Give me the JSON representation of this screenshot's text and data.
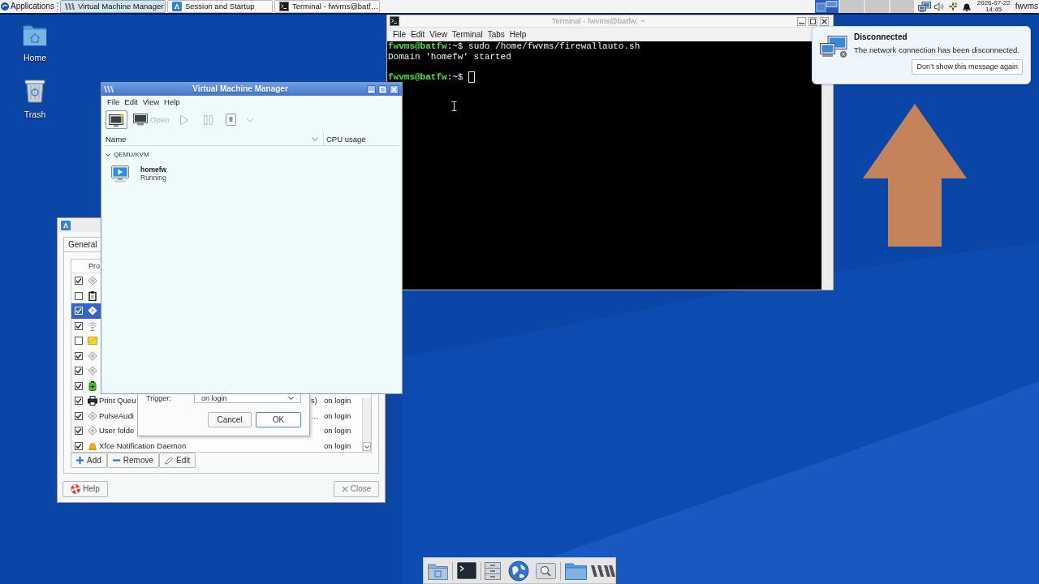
{
  "top_panel": {
    "applications": "Applications",
    "tasks": [
      {
        "kind": "vmm",
        "label": "Virtual Machine Manager",
        "selected": true
      },
      {
        "kind": "session",
        "label": "Session and Startup",
        "selected": false
      },
      {
        "kind": "terminal",
        "label": "Terminal - fwvms@batf…",
        "selected": false
      }
    ],
    "workspaces": [
      {
        "selected": true,
        "windows": true
      },
      {
        "selected": false,
        "windows": false
      },
      {
        "selected": false,
        "windows": false
      },
      {
        "selected": false,
        "windows": false
      }
    ],
    "clock": {
      "date": "2026-07-22",
      "time": "14:45"
    },
    "user": "fwvms"
  },
  "desktop_icons": [
    {
      "kind": "home",
      "label": "Home"
    },
    {
      "kind": "trash",
      "label": "Trash"
    }
  ],
  "terminal": {
    "title": "Terminal - fwvms@batfw: ~",
    "menu": [
      "File",
      "Edit",
      "View",
      "Terminal",
      "Tabs",
      "Help"
    ],
    "lines": [
      {
        "kind": "prompt",
        "user_host": "fwvms@batfw",
        "path": ":~",
        "sign": "$",
        "command": "sudo /home/fwvms/firewallauto.sh",
        "cursor": false
      },
      {
        "kind": "output",
        "text": "Domain 'homefw' started"
      },
      {
        "kind": "blank"
      },
      {
        "kind": "prompt",
        "user_host": "fwvms@batfw",
        "path": ":~",
        "sign": "$",
        "cursor": true
      }
    ]
  },
  "notification": {
    "title": "Disconnected",
    "body": "The network connection has been disconnected.",
    "button": "Don’t show this message again"
  },
  "vmm": {
    "title": "Virtual Machine Manager",
    "menu": [
      "File",
      "Edit",
      "View",
      "Help"
    ],
    "toolbar": [
      {
        "kind": "new",
        "focused": true,
        "disabled": false
      },
      {
        "kind": "open",
        "label": "Open",
        "focused": false,
        "disabled": true
      },
      {
        "kind": "run",
        "focused": false,
        "disabled": true
      },
      {
        "kind": "pause",
        "focused": false,
        "disabled": true
      },
      {
        "kind": "shutdown",
        "focused": false,
        "disabled": true
      },
      {
        "kind": "dropdown",
        "focused": false,
        "disabled": true
      }
    ],
    "columns": [
      "Name",
      "CPU usage"
    ],
    "groups": [
      {
        "label": "QEMU/KVM",
        "expanded": true,
        "vms": [
          {
            "name": "homefw",
            "status": "Running"
          }
        ]
      }
    ]
  },
  "session": {
    "tabs": [
      {
        "label": "General",
        "selected": true
      }
    ],
    "list_header": "Pro",
    "rows": [
      {
        "kind": "app",
        "checked": true,
        "selected": false
      },
      {
        "kind": "clipboard",
        "checked": false,
        "selected": false
      },
      {
        "kind": "app",
        "checked": true,
        "selected": true
      },
      {
        "kind": "network",
        "checked": true,
        "selected": false
      },
      {
        "kind": "note",
        "checked": false,
        "selected": false
      },
      {
        "kind": "app",
        "checked": true,
        "selected": false
      },
      {
        "kind": "app",
        "checked": true,
        "selected": false
      },
      {
        "kind": "power",
        "checked": true,
        "selected": false
      },
      {
        "kind": "printer",
        "checked": true,
        "selected": false,
        "name": "Print Queu",
        "description": "s)",
        "trigger": "on login"
      },
      {
        "kind": "app",
        "checked": true,
        "selected": false,
        "name": "PulseAudi",
        "description": "…",
        "trigger": "on login"
      },
      {
        "kind": "app",
        "checked": true,
        "selected": false,
        "name": "User folde",
        "trigger": "on login"
      },
      {
        "kind": "bell",
        "checked": true,
        "selected": false,
        "name": "Xfce Notification Daemon",
        "trigger": "on login"
      }
    ],
    "buttons": [
      {
        "kind": "add",
        "label": "Add"
      },
      {
        "kind": "remove",
        "label": "Remove"
      },
      {
        "kind": "edit",
        "label": "Edit"
      }
    ],
    "help": "Help",
    "close": "Close",
    "dialog": {
      "label": "Trigger:",
      "value": "on login",
      "buttons": [
        {
          "label": "Cancel",
          "default": false
        },
        {
          "label": "OK",
          "default": true
        }
      ]
    }
  }
}
